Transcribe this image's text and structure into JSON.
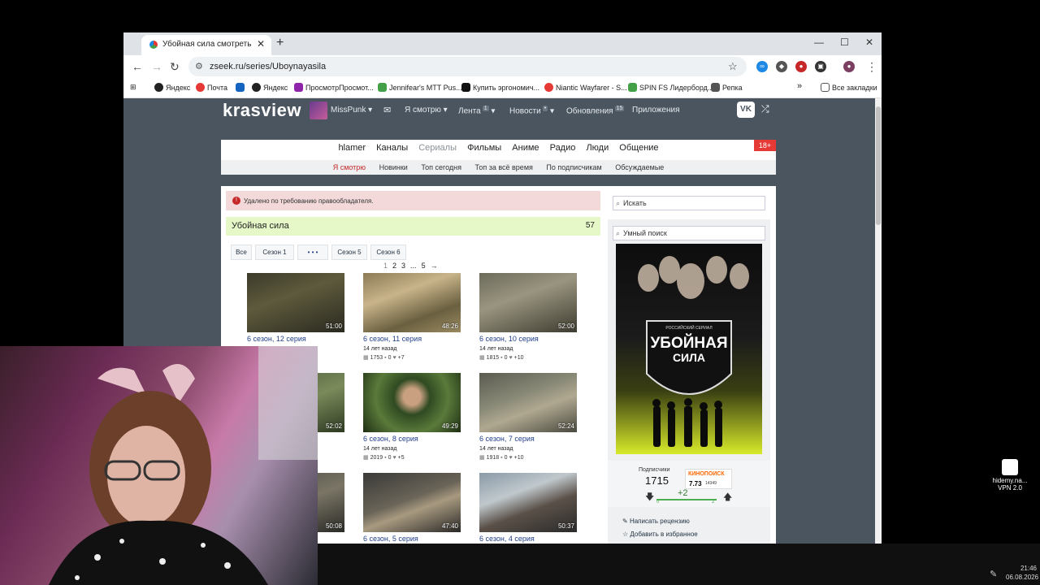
{
  "browser": {
    "tab_title": "Убойная сила смотреть онлайн",
    "new_tab": "+",
    "tab_close": "✕",
    "url": "zseek.ru/series/Uboynayasila",
    "bookmarks": [
      {
        "label": "Яндекс",
        "color": "#222222"
      },
      {
        "label": "Почта",
        "color": "#e53935"
      },
      {
        "label": "",
        "color": "#1565c0"
      },
      {
        "label": "Яндекс",
        "color": "#222222"
      },
      {
        "label": "ПросмотрПросмот...",
        "color": "#8e24aa"
      },
      {
        "label": "Jennifear's MTT Pus...",
        "color": "#43a047"
      },
      {
        "label": "Купить эргономич...",
        "color": "#111111"
      },
      {
        "label": "Niantic Wayfarer - S...",
        "color": "#e53935"
      },
      {
        "label": "SPIN FS Лидерборд...",
        "color": "#43a047"
      },
      {
        "label": "Репка",
        "color": "#555555"
      }
    ],
    "more_bookmarks": "»",
    "all_bookmarks": "Все закладки"
  },
  "site": {
    "logo": "krasview",
    "user": "MissPunk",
    "nav": [
      {
        "label": "Я смотрю",
        "badge": ""
      },
      {
        "label": "Лента",
        "badge": "1"
      },
      {
        "label": "Новости",
        "badge": "•"
      },
      {
        "label": "Обновления",
        "badge": "15"
      },
      {
        "label": "Приложения",
        "badge": ""
      }
    ],
    "vk": "VK",
    "categories": [
      "hlamer",
      "Каналы",
      "Сериалы",
      "Фильмы",
      "Аниме",
      "Радио",
      "Люди",
      "Общение"
    ],
    "active_category": "Сериалы",
    "subcategories": [
      "Я смотрю",
      "Новинки",
      "Топ сегодня",
      "Топ за всё время",
      "По подписчикам",
      "Обсуждаемые"
    ],
    "age_badge": "18+",
    "alert": "Удалено по требованию правообладателя.",
    "series_title": "Убойная сила",
    "series_count": "57",
    "season_tabs": [
      "Все",
      "Сезон 1",
      "• • •",
      "Сезон 5",
      "Сезон 6"
    ],
    "pager": [
      "1",
      "2",
      "3",
      "...",
      "5",
      "→"
    ],
    "episodes": [
      {
        "title": "6 сезон, 12 серия",
        "ago": "",
        "views": "",
        "comments": "",
        "likes": "",
        "duration": "51:00"
      },
      {
        "title": "6 сезон, 11 серия",
        "ago": "14 лет назад",
        "views": "1753",
        "comments": "0",
        "likes": "+7",
        "duration": "48:26"
      },
      {
        "title": "6 сезон, 10 серия",
        "ago": "14 лет назад",
        "views": "1815",
        "comments": "0",
        "likes": "+10",
        "duration": "52:00"
      },
      {
        "title": "",
        "ago": "",
        "views": "",
        "comments": "",
        "likes": "",
        "duration": "52:02"
      },
      {
        "title": "6 сезон, 8 серия",
        "ago": "14 лет назад",
        "views": "2019",
        "comments": "0",
        "likes": "+5",
        "duration": "49:29"
      },
      {
        "title": "6 сезон, 7 серия",
        "ago": "14 лет назад",
        "views": "1918",
        "comments": "0",
        "likes": "+10",
        "duration": "52:24"
      },
      {
        "title": "",
        "ago": "",
        "views": "",
        "comments": "",
        "likes": "",
        "duration": "50:08"
      },
      {
        "title": "6 сезон, 5 серия",
        "ago": "",
        "views": "",
        "comments": "",
        "likes": "",
        "duration": "47:40"
      },
      {
        "title": "6 сезон, 4 серия",
        "ago": "",
        "views": "",
        "comments": "",
        "likes": "",
        "duration": "50:37"
      }
    ],
    "partial_text": "5",
    "search_placeholder": "Искать",
    "smart_search_placeholder": "Умный поиск",
    "poster_small": "РОССИЙСКИЙ СЕРИАЛ",
    "poster_title_1": "УБОЙНАЯ",
    "poster_title_2": "СИЛА",
    "subscribers_label": "Подписчики",
    "subscribers": "1715",
    "kp_label": "КИНОПОИСК",
    "kp_rating": "7.73",
    "kp_votes": "14349",
    "vote_value": "+2",
    "vote_min": "0",
    "vote_max": "2",
    "write_review": "Написать рецензию",
    "add_favorite": "Добавить в избранное"
  },
  "desktop": {
    "vpn_label": "hidemy.na...",
    "vpn_sub": "VPN 2.0",
    "time": "21:46",
    "date": "06.08.2026"
  }
}
